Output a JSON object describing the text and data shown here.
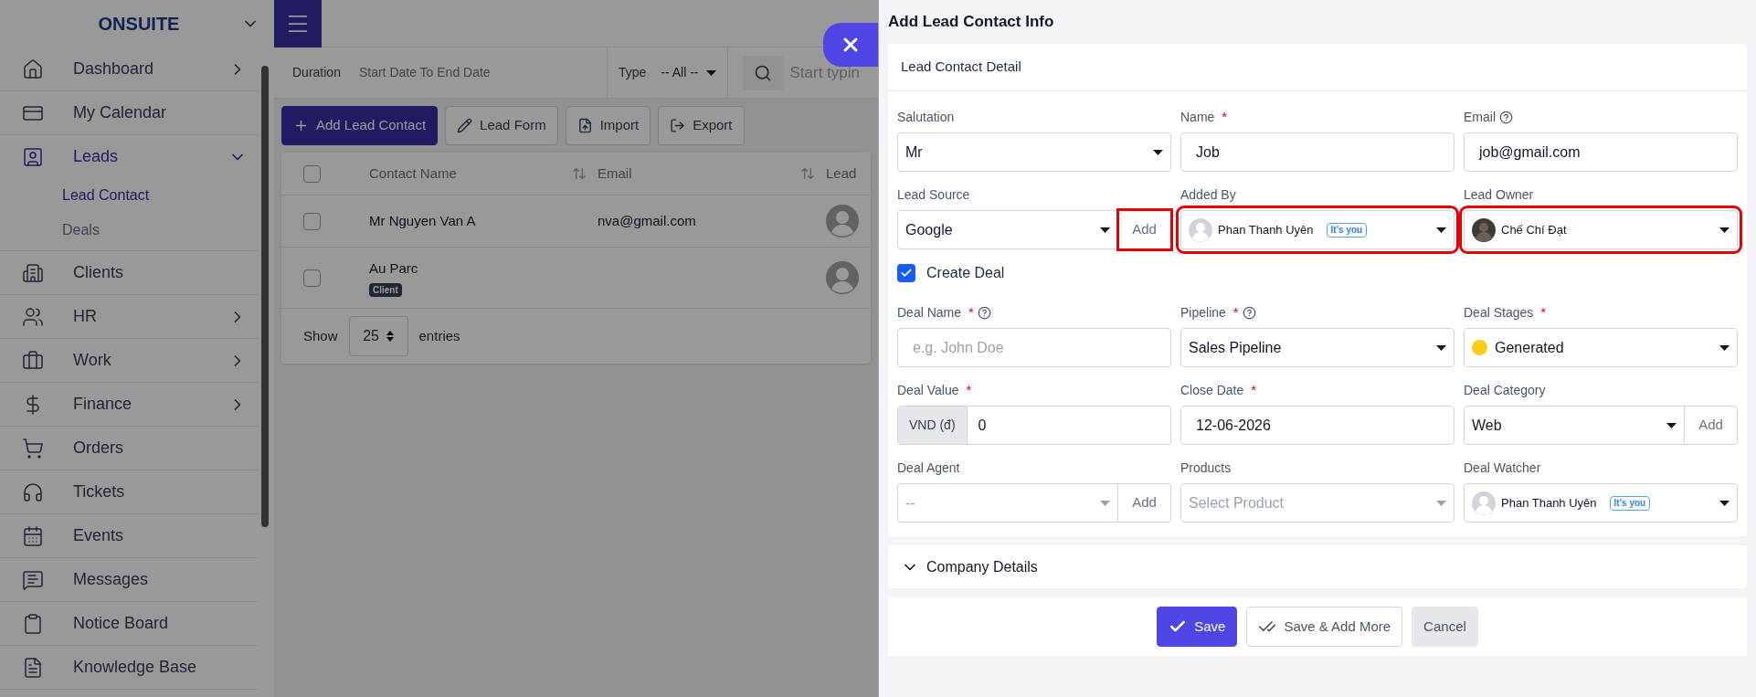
{
  "brand": "ONSUITE",
  "sidebar": {
    "items": [
      {
        "label": "Dashboard",
        "expanded": false
      },
      {
        "label": "My Calendar"
      },
      {
        "label": "Leads",
        "expanded": true,
        "selected": true,
        "children": [
          {
            "label": "Lead Contact",
            "selected": true
          },
          {
            "label": "Deals",
            "selected": false
          }
        ]
      },
      {
        "label": "Clients"
      },
      {
        "label": "HR",
        "expanded": false
      },
      {
        "label": "Work",
        "expanded": false
      },
      {
        "label": "Finance",
        "expanded": false
      },
      {
        "label": "Orders"
      },
      {
        "label": "Tickets"
      },
      {
        "label": "Events"
      },
      {
        "label": "Messages"
      },
      {
        "label": "Notice Board"
      },
      {
        "label": "Knowledge Base"
      }
    ]
  },
  "filters": {
    "duration_label": "Duration",
    "duration_value": "Start Date To End Date",
    "type_label": "Type",
    "type_value": "-- All --",
    "search_placeholder": "Start typin"
  },
  "toolbar": [
    {
      "label": "Add Lead Contact",
      "kind": "primary"
    },
    {
      "label": "Lead Form",
      "kind": "form"
    },
    {
      "label": "Import",
      "kind": "import"
    },
    {
      "label": "Export",
      "kind": "export"
    }
  ],
  "table": {
    "columns": [
      {
        "label": "Contact Name",
        "sortable": true
      },
      {
        "label": "Email",
        "sortable": true
      },
      {
        "label": "Lead",
        "sortable": false
      }
    ],
    "select_all_checked": false,
    "rows": [
      {
        "name": "Mr Nguyen Van A",
        "email": "nva@gmail.com",
        "checked": false
      },
      {
        "name": "Au Parc",
        "badge": "Client",
        "checked": false
      }
    ],
    "show_label": "Show",
    "page_size": "25",
    "entries_label": "entries"
  },
  "drawer": {
    "title": "Add Lead Contact Info",
    "section": "Lead Contact Detail",
    "contact_fields": [
      {
        "label": "Salutation",
        "kind": "select",
        "value": "Mr"
      },
      {
        "label": "Name",
        "required": "*",
        "kind": "text",
        "value": "Job"
      },
      {
        "label": "Email",
        "help": true,
        "kind": "text",
        "value": "job@gmail.com"
      },
      {
        "label": "Lead Source",
        "kind": "select-add",
        "value": "Google",
        "add_label": "Add",
        "add_highlighted": true
      },
      {
        "label": "Added By",
        "kind": "user-select",
        "value": "Phan Thanh Uyên",
        "badge": "It's you",
        "highlighted": true
      },
      {
        "label": "Lead Owner",
        "kind": "user-select",
        "value": "Chế Chí Đạt",
        "highlighted": true
      }
    ],
    "create_deal": {
      "label": "Create Deal",
      "checked": true
    },
    "deal_fields": [
      {
        "label": "Deal Name",
        "required": "*",
        "help": true,
        "kind": "text",
        "placeholder": "e.g. John Doe"
      },
      {
        "label": "Pipeline",
        "required": "*",
        "help": true,
        "kind": "select",
        "value": "Sales Pipeline"
      },
      {
        "label": "Deal Stages",
        "required": "*",
        "kind": "select",
        "value": "Generated",
        "color": "#facc15"
      },
      {
        "label": "Deal Value",
        "required": "*",
        "kind": "prefix",
        "prefix": "VND (đ)",
        "value": "0"
      },
      {
        "label": "Close Date",
        "required": "*",
        "kind": "text",
        "value": "12-06-2026"
      },
      {
        "label": "Deal Category",
        "kind": "select-group",
        "value": "Web",
        "add_label": "Add"
      },
      {
        "label": "Deal Agent",
        "kind": "select-group",
        "placeholder": "--",
        "add_label": "Add"
      },
      {
        "label": "Products",
        "kind": "select",
        "placeholder": "Select Product"
      },
      {
        "label": "Deal Watcher",
        "kind": "user-select",
        "value": "Phan Thanh Uyên",
        "badge": "It's you"
      }
    ],
    "company": {
      "label": "Company Details",
      "expanded": false
    },
    "buttons": [
      {
        "label": "Save",
        "kind": "primary"
      },
      {
        "label": "Save & Add More",
        "kind": "secondary"
      },
      {
        "label": "Cancel",
        "kind": "cancel"
      }
    ]
  }
}
